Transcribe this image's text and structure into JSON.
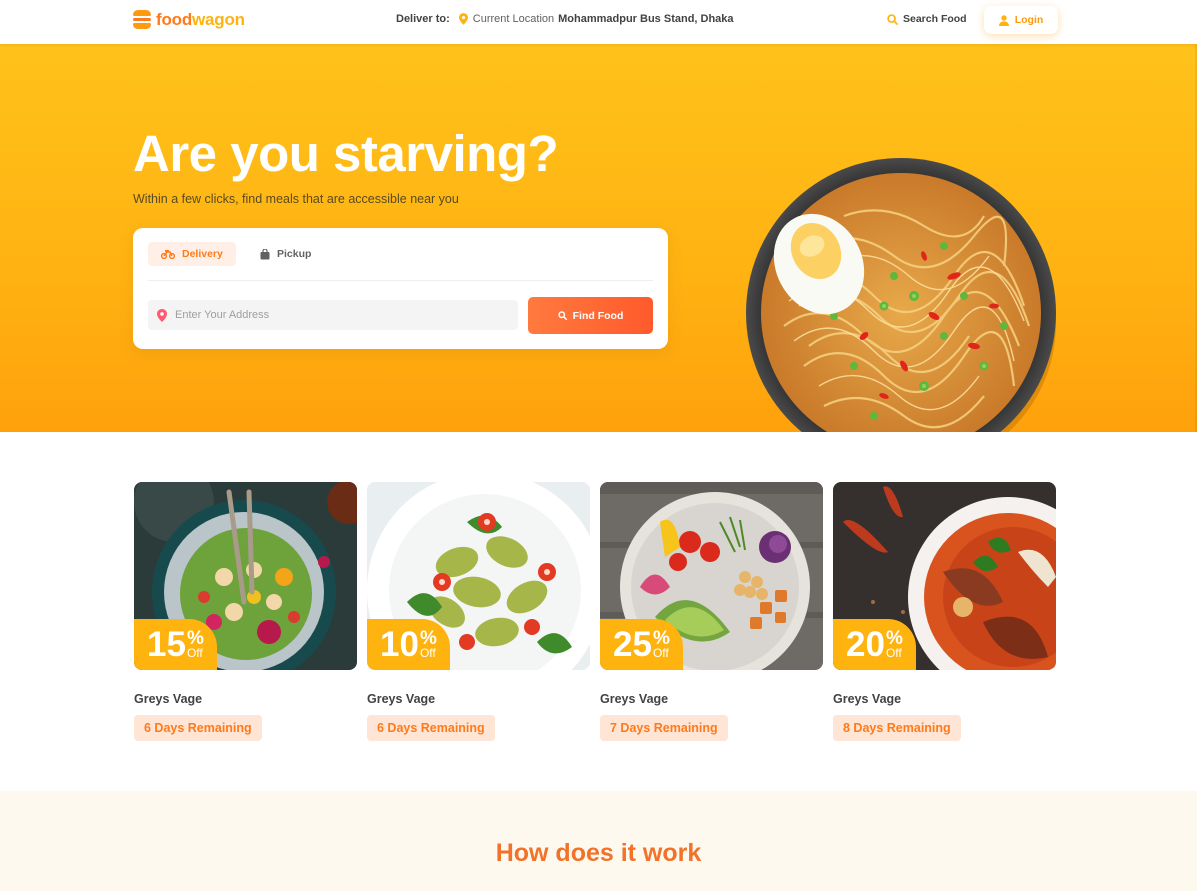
{
  "header": {
    "logo_food": "food",
    "logo_wagon": "wagon",
    "deliver_label": "Deliver to:",
    "current_location": "Current Location",
    "place": "Mohammadpur Bus Stand, Dhaka",
    "search_label": "Search Food",
    "login_label": "Login"
  },
  "hero": {
    "title": "Are you starving?",
    "subtitle": "Within a few clicks, find meals that are accessible near you",
    "tabs": [
      {
        "label": "Delivery",
        "icon": "motorbike-icon",
        "active": true
      },
      {
        "label": "Pickup",
        "icon": "bag-icon",
        "active": false
      }
    ],
    "address_placeholder": "Enter Your Address",
    "find_button": "Find Food"
  },
  "deals": [
    {
      "percent": "15",
      "symbol": "%",
      "off": "Off",
      "name": "Greys Vage",
      "remaining": "6 Days Remaining"
    },
    {
      "percent": "10",
      "symbol": "%",
      "off": "Off",
      "name": "Greys Vage",
      "remaining": "6 Days Remaining"
    },
    {
      "percent": "25",
      "symbol": "%",
      "off": "Off",
      "name": "Greys Vage",
      "remaining": "7 Days Remaining"
    },
    {
      "percent": "20",
      "symbol": "%",
      "off": "Off",
      "name": "Greys Vage",
      "remaining": "8 Days Remaining"
    }
  ],
  "how": {
    "title": "How does it work"
  },
  "colors": {
    "primary_orange": "#ff7a1a",
    "hero_yellow": "#ffc21a",
    "badge_yellow": "#ffb30e",
    "find_button": "#ff5a2b",
    "section_title": "#f17228"
  }
}
